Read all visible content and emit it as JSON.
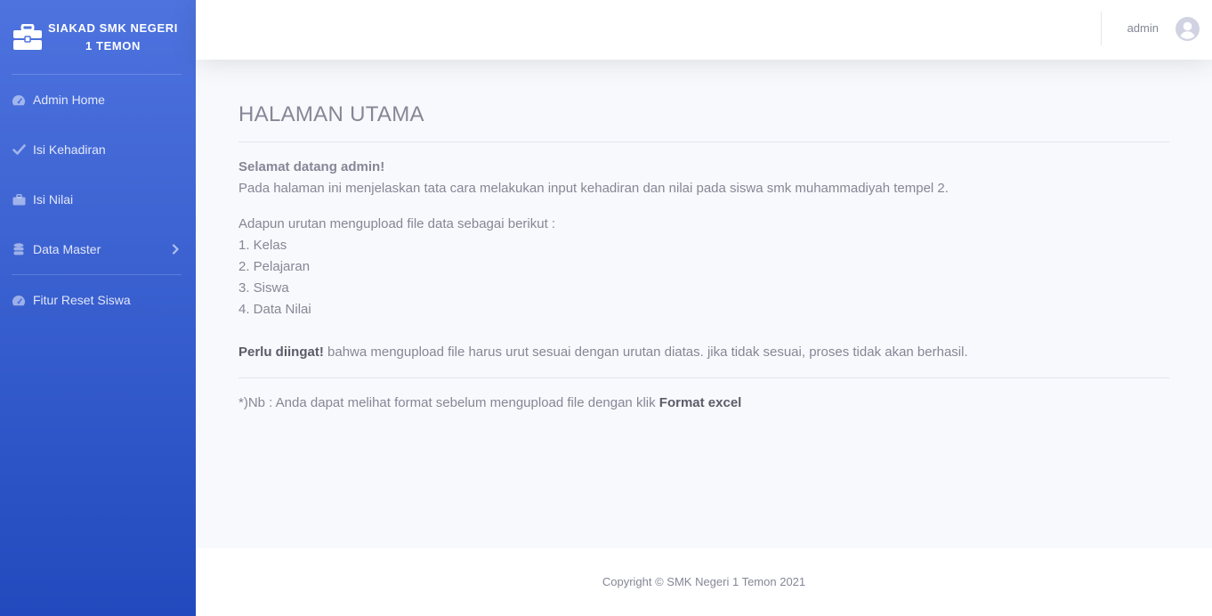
{
  "sidebar": {
    "brand_line1": "SIAKAD SMK NEGERI",
    "brand_line2": "1 TEMON",
    "brand_icon": "briefcase-icon",
    "items": [
      {
        "label": "Admin Home",
        "icon": "tachometer-icon"
      },
      {
        "label": "Isi Kehadiran",
        "icon": "check-icon"
      },
      {
        "label": "Isi Nilai",
        "icon": "briefcase-icon"
      },
      {
        "label": "Data Master",
        "icon": "database-icon",
        "chevron": "chevron-right-icon"
      },
      {
        "label": "Fitur Reset Siswa",
        "icon": "tachometer-icon"
      }
    ]
  },
  "topbar": {
    "user_name": "admin",
    "avatar_icon": "user-circle-icon"
  },
  "main": {
    "title": "HALAMAN UTAMA",
    "welcome": "Selamat datang admin!",
    "intro": "Pada halaman ini menjelaskan tata cara melakukan input kehadiran dan nilai pada siswa smk muhammadiyah tempel 2.",
    "steps_heading": "Adapun urutan mengupload file data sebagai berikut :",
    "steps": [
      "1. Kelas",
      "2. Pelajaran",
      "3. Siswa",
      "4. Data Nilai"
    ],
    "warning_bold": "Perlu diingat!",
    "warning_text": " bahwa mengupload file harus urut sesuai dengan urutan diatas. jika tidak sesuai, proses tidak akan berhasil.",
    "note_text": "*)Nb : Anda dapat melihat format sebelum mengupload file dengan klik ",
    "note_link": "Format excel"
  },
  "footer": {
    "copyright": "Copyright © SMK Negeri 1 Temon 2021"
  },
  "colors": {
    "sidebar_top": "#4e73df",
    "sidebar_bottom": "#224abe",
    "text_muted": "#858796",
    "background": "#f8f9fc"
  }
}
